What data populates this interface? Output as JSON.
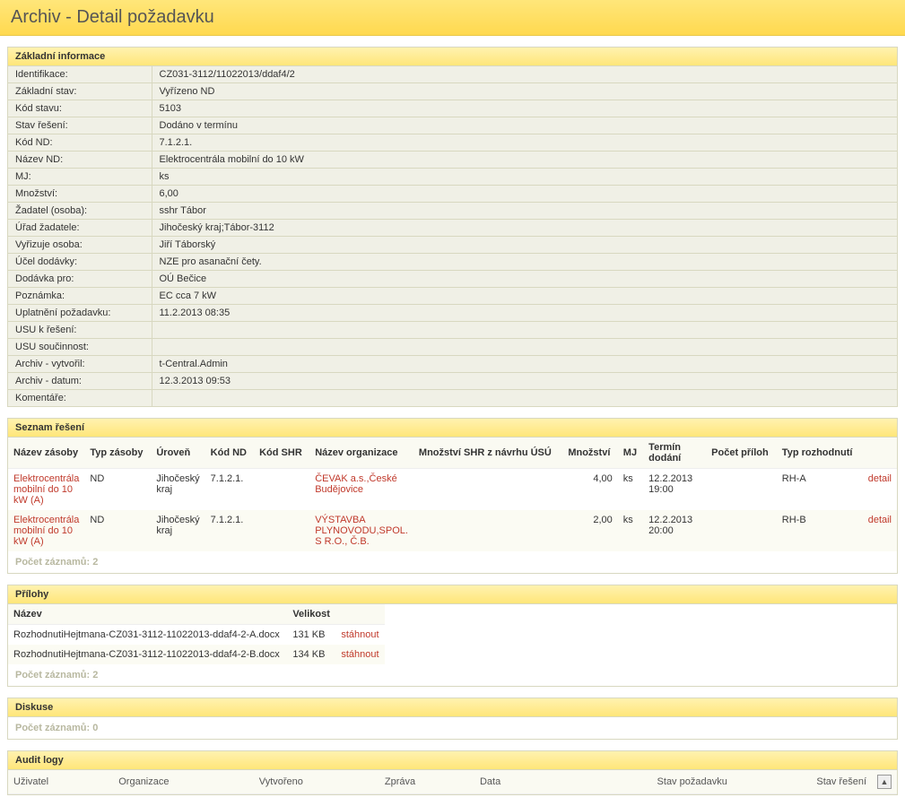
{
  "pageTitle": "Archiv - Detail požadavku",
  "basic": {
    "header": "Základní informace",
    "rows": [
      {
        "label": "Identifikace:",
        "value": "CZ031-3112/11022013/ddaf4/2"
      },
      {
        "label": "Základní stav:",
        "value": "Vyřízeno ND"
      },
      {
        "label": "Kód stavu:",
        "value": "5103"
      },
      {
        "label": "Stav řešení:",
        "value": "Dodáno v termínu"
      },
      {
        "label": "Kód ND:",
        "value": "7.1.2.1."
      },
      {
        "label": "Název ND:",
        "value": "Elektrocentrála mobilní do 10 kW"
      },
      {
        "label": "MJ:",
        "value": "ks"
      },
      {
        "label": "Množství:",
        "value": "6,00"
      },
      {
        "label": "Žadatel (osoba):",
        "value": "sshr Tábor"
      },
      {
        "label": "Úřad žadatele:",
        "value": "Jihočeský kraj;Tábor-3112"
      },
      {
        "label": "Vyřizuje osoba:",
        "value": "Jiří Táborský"
      },
      {
        "label": "Účel dodávky:",
        "value": "NZE pro asanační čety."
      },
      {
        "label": "Dodávka pro:",
        "value": "OÚ Bečice"
      },
      {
        "label": "Poznámka:",
        "value": "EC cca 7 kW"
      },
      {
        "label": "Uplatnění požadavku:",
        "value": "11.2.2013 08:35"
      },
      {
        "label": "USU k řešení:",
        "value": ""
      },
      {
        "label": "USU součinnost:",
        "value": ""
      },
      {
        "label": "Archiv - vytvořil:",
        "value": "t-Central.Admin"
      },
      {
        "label": "Archiv - datum:",
        "value": "12.3.2013 09:53"
      },
      {
        "label": "Komentáře:",
        "value": ""
      }
    ]
  },
  "solutions": {
    "header": "Seznam řešení",
    "columns": [
      "Název zásoby",
      "Typ zásoby",
      "Úroveň",
      "Kód ND",
      "Kód SHR",
      "Název organizace",
      "Množství SHR z návrhu ÚSÚ",
      "Množství",
      "MJ",
      "Termín dodání",
      "Počet příloh",
      "Typ rozhodnutí",
      ""
    ],
    "rows": [
      {
        "nazev": "Elektrocentrála mobilní do 10 kW (A)",
        "typ": "ND",
        "uroven": "Jihočeský kraj",
        "kodnd": "7.1.2.1.",
        "kodshr": "",
        "org": "ČEVAK a.s.,České Budějovice",
        "mnozSHR": "",
        "mnoz": "4,00",
        "mj": "ks",
        "termin": "12.2.2013 19:00",
        "priloh": "",
        "typroz": "RH-A",
        "detail": "detail"
      },
      {
        "nazev": "Elektrocentrála mobilní do 10 kW (A)",
        "typ": "ND",
        "uroven": "Jihočeský kraj",
        "kodnd": "7.1.2.1.",
        "kodshr": "",
        "org": "VÝSTAVBA PLYNOVODU,SPOL. S R.O., Č.B.",
        "mnozSHR": "",
        "mnoz": "2,00",
        "mj": "ks",
        "termin": "12.2.2013 20:00",
        "priloh": "",
        "typroz": "RH-B",
        "detail": "detail"
      }
    ],
    "countLabel": "Počet záznamů:",
    "count": "2"
  },
  "attachments": {
    "header": "Přílohy",
    "columns": [
      "Název",
      "Velikost",
      ""
    ],
    "rows": [
      {
        "name": "RozhodnutiHejtmana-CZ031-3112-11022013-ddaf4-2-A.docx",
        "size": "131 KB",
        "action": "stáhnout"
      },
      {
        "name": "RozhodnutiHejtmana-CZ031-3112-11022013-ddaf4-2-B.docx",
        "size": "134 KB",
        "action": "stáhnout"
      }
    ],
    "countLabel": "Počet záznamů:",
    "count": "2"
  },
  "discussion": {
    "header": "Diskuse",
    "countLabel": "Počet záznamů:",
    "count": "0"
  },
  "audit": {
    "header": "Audit logy",
    "columns": [
      "Uživatel",
      "Organizace",
      "Vytvořeno",
      "Zpráva",
      "Data",
      "Stav požadavku",
      "Stav řešení"
    ]
  }
}
